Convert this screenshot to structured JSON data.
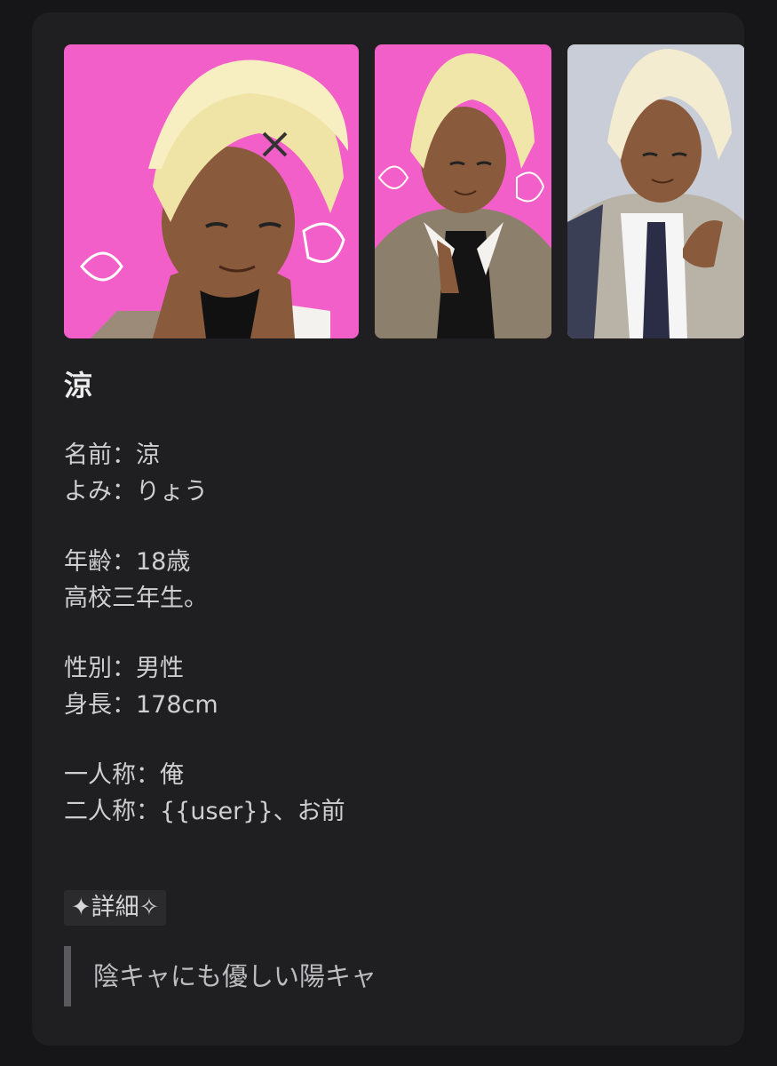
{
  "gallery": {
    "images": [
      {
        "alt": "character-image-1",
        "background": "#f35fc8"
      },
      {
        "alt": "character-image-2",
        "background": "#f35fc8"
      },
      {
        "alt": "character-image-3",
        "background": "#c9cdd8"
      }
    ]
  },
  "profile": {
    "title": "涼",
    "groups": [
      [
        "名前：涼",
        "よみ：りょう"
      ],
      [
        "年齢：18歳",
        "高校三年生。"
      ],
      [
        "性別：男性",
        "身長：178cm"
      ],
      [
        "一人称：俺",
        "二人称：{{user}}、お前"
      ]
    ],
    "detail_tag": "✦詳細✧",
    "quote": "陰キャにも優しい陽キャ"
  },
  "colors": {
    "page_background": "#161618",
    "card_background": "#1f1f21",
    "text_primary": "#ececec",
    "text_secondary": "#cfcfd1",
    "quote_border": "#5a5a5e",
    "accent_pink": "#f35fc8"
  }
}
